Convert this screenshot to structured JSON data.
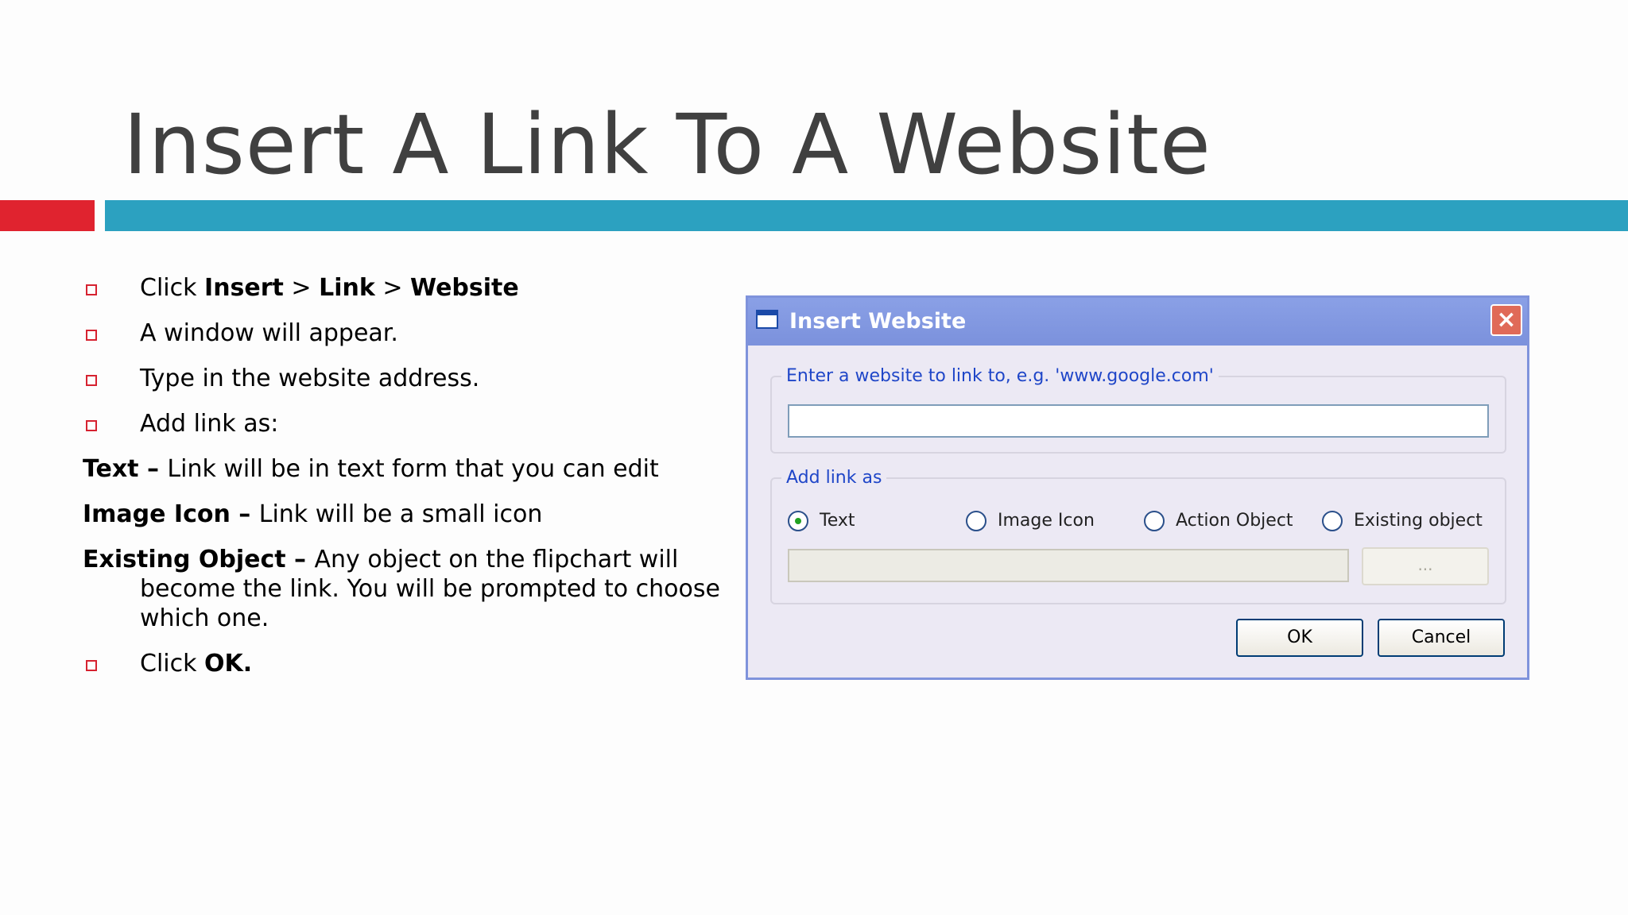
{
  "slide": {
    "title": "Insert A Link To A Website",
    "colors": {
      "title": "#404040",
      "red_bar": "#e0232f",
      "blue_bar": "#2ca1c0",
      "bullet": "#d62230"
    }
  },
  "content": {
    "step1": {
      "pre": "Click ",
      "insert": "Insert",
      "sep1": " > ",
      "link": "Link",
      "sep2": " > ",
      "website": "Website"
    },
    "step2": "A window will appear.",
    "step3": "Type in the website address.",
    "step4": "Add link as:",
    "def_text": {
      "term": "Text – ",
      "desc": "Link will be in text form that you can edit"
    },
    "def_image": {
      "term": "Image Icon – ",
      "desc": "Link will be a small icon"
    },
    "def_existing": {
      "term": "Existing Object – ",
      "desc": "Any object on the flipchart will",
      "line2": "become the link.  You will be prompted to choose",
      "line3": "which one."
    },
    "step5": {
      "pre": "Click ",
      "ok": "OK."
    }
  },
  "dialog": {
    "title": "Insert Website",
    "close_icon": "close-x",
    "url_group_label": "Enter a website to link to, e.g. 'www.google.com'",
    "url_value": "",
    "add_link_label": "Add link as",
    "options": [
      {
        "label": "Text",
        "checked": true
      },
      {
        "label": "Image Icon",
        "checked": false
      },
      {
        "label": "Action Object",
        "checked": false
      },
      {
        "label": "Existing object",
        "checked": false
      }
    ],
    "browse_label": "...",
    "ok_label": "OK",
    "cancel_label": "Cancel",
    "colors": {
      "titlebar": "#7f93dc",
      "legend_text": "#1f46c8",
      "close": "#e06a58"
    }
  }
}
